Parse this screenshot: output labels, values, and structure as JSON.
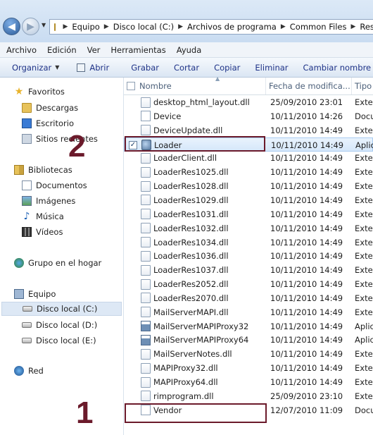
{
  "address": {
    "crumbs": [
      "Equipo",
      "Disco local (C:)",
      "Archivos de programa",
      "Common Files",
      "Rese"
    ]
  },
  "menu": [
    "Archivo",
    "Edición",
    "Ver",
    "Herramientas",
    "Ayuda"
  ],
  "toolbar": {
    "organize_label": "Organizar",
    "open_label": "Abrir",
    "items": [
      "Grabar",
      "Cortar",
      "Copiar",
      "Eliminar",
      "Cambiar nombre"
    ]
  },
  "nav": {
    "favorites": "Favoritos",
    "fav_items": [
      "Descargas",
      "Escritorio",
      "Sitios recientes"
    ],
    "libraries": "Bibliotecas",
    "lib_items": [
      "Documentos",
      "Imágenes",
      "Música",
      "Vídeos"
    ],
    "homegroup": "Grupo en el hogar",
    "computer": "Equipo",
    "drives": [
      "Disco local (C:)",
      "Disco local (D:)",
      "Disco local (E:)"
    ],
    "network": "Red"
  },
  "columns": {
    "name": "Nombre",
    "date": "Fecha de modifica...",
    "type": "Tipo"
  },
  "files": [
    {
      "name": "desktop_html_layout.dll",
      "date": "25/09/2010 23:01",
      "type": "Exter",
      "icon": "dll"
    },
    {
      "name": "Device",
      "date": "10/11/2010 14:26",
      "type": "Docu",
      "icon": "doc"
    },
    {
      "name": "DeviceUpdate.dll",
      "date": "10/11/2010 14:49",
      "type": "Exter",
      "icon": "dll"
    },
    {
      "name": "Loader",
      "date": "10/11/2010 14:49",
      "type": "Aplic",
      "icon": "loader",
      "selected": true
    },
    {
      "name": "LoaderClient.dll",
      "date": "10/11/2010 14:49",
      "type": "Exter",
      "icon": "dll"
    },
    {
      "name": "LoaderRes1025.dll",
      "date": "10/11/2010 14:49",
      "type": "Exter",
      "icon": "dll"
    },
    {
      "name": "LoaderRes1028.dll",
      "date": "10/11/2010 14:49",
      "type": "Exter",
      "icon": "dll"
    },
    {
      "name": "LoaderRes1029.dll",
      "date": "10/11/2010 14:49",
      "type": "Exter",
      "icon": "dll"
    },
    {
      "name": "LoaderRes1031.dll",
      "date": "10/11/2010 14:49",
      "type": "Exter",
      "icon": "dll"
    },
    {
      "name": "LoaderRes1032.dll",
      "date": "10/11/2010 14:49",
      "type": "Exter",
      "icon": "dll"
    },
    {
      "name": "LoaderRes1034.dll",
      "date": "10/11/2010 14:49",
      "type": "Exter",
      "icon": "dll"
    },
    {
      "name": "LoaderRes1036.dll",
      "date": "10/11/2010 14:49",
      "type": "Exter",
      "icon": "dll"
    },
    {
      "name": "LoaderRes1037.dll",
      "date": "10/11/2010 14:49",
      "type": "Exter",
      "icon": "dll"
    },
    {
      "name": "LoaderRes2052.dll",
      "date": "10/11/2010 14:49",
      "type": "Exter",
      "icon": "dll"
    },
    {
      "name": "LoaderRes2070.dll",
      "date": "10/11/2010 14:49",
      "type": "Exter",
      "icon": "dll"
    },
    {
      "name": "MailServerMAPI.dll",
      "date": "10/11/2010 14:49",
      "type": "Exter",
      "icon": "dll"
    },
    {
      "name": "MailServerMAPIProxy32",
      "date": "10/11/2010 14:49",
      "type": "Aplic",
      "icon": "app"
    },
    {
      "name": "MailServerMAPIProxy64",
      "date": "10/11/2010 14:49",
      "type": "Aplic",
      "icon": "app"
    },
    {
      "name": "MailServerNotes.dll",
      "date": "10/11/2010 14:49",
      "type": "Exter",
      "icon": "dll"
    },
    {
      "name": "MAPIProxy32.dll",
      "date": "10/11/2010 14:49",
      "type": "Exter",
      "icon": "dll"
    },
    {
      "name": "MAPIProxy64.dll",
      "date": "10/11/2010 14:49",
      "type": "Exter",
      "icon": "dll"
    },
    {
      "name": "rimprogram.dll",
      "date": "25/09/2010 23:10",
      "type": "Exter",
      "icon": "dll"
    },
    {
      "name": "Vendor",
      "date": "12/07/2010 11:09",
      "type": "Docu",
      "icon": "doc2"
    }
  ],
  "annotations": {
    "step1": "1",
    "step2": "2",
    "color": "#6b1a2b"
  }
}
